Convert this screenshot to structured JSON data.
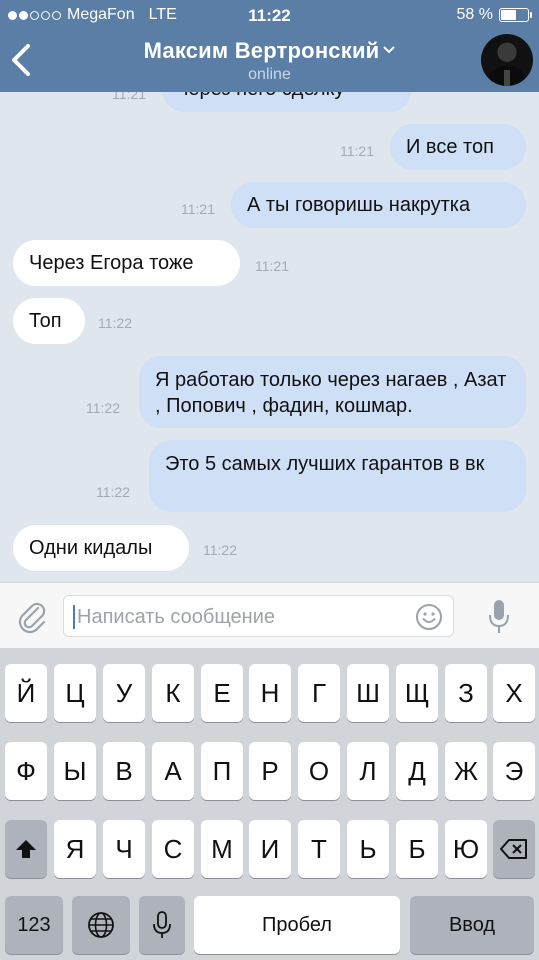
{
  "status_bar": {
    "carrier": "MegaFon",
    "network": "LTE",
    "time": "11:22",
    "battery_percent_text": "58 %",
    "battery_level": 0.58
  },
  "header": {
    "title": "Максим Вертронский",
    "subtitle": "online",
    "back_icon": "chevron-left-icon",
    "title_chevron_icon": "chevron-down-icon"
  },
  "messages": [
    {
      "text": "через него сделку",
      "time": "11:21",
      "direction": "out"
    },
    {
      "text": "И все топ",
      "time": "11:21",
      "direction": "out"
    },
    {
      "text": "А ты говоришь накрутка",
      "time": "11:21",
      "direction": "out"
    },
    {
      "text": "Через Егора тоже",
      "time": "11:21",
      "direction": "in"
    },
    {
      "text": "Топ",
      "time": "11:22",
      "direction": "in"
    },
    {
      "text": "Я работаю только через нагаев , Азат , Попович , фадин, кошмар.",
      "time": "11:22",
      "direction": "out"
    },
    {
      "text": "Это 5 самых лучших гарантов в вк",
      "time": "11:22",
      "direction": "out"
    },
    {
      "text": "Одни кидалы",
      "time": "11:22",
      "direction": "in"
    }
  ],
  "composer": {
    "placeholder": "Написать сообщение",
    "attach_icon": "paperclip-icon",
    "emoji_icon": "smiley-icon",
    "voice_icon": "microphone-icon"
  },
  "keyboard": {
    "row1": [
      "Й",
      "Ц",
      "У",
      "К",
      "Е",
      "Н",
      "Г",
      "Ш",
      "Щ",
      "З",
      "Х"
    ],
    "row2": [
      "Ф",
      "Ы",
      "В",
      "А",
      "П",
      "Р",
      "О",
      "Л",
      "Д",
      "Ж",
      "Э"
    ],
    "row3": [
      "Я",
      "Ч",
      "С",
      "М",
      "И",
      "Т",
      "Ь",
      "Б",
      "Ю"
    ],
    "numbers_label": "123",
    "space_label": "Пробел",
    "return_label": "Ввод",
    "shift_icon": "shift-icon",
    "delete_icon": "backspace-icon",
    "globe_icon": "globe-icon",
    "dictation_icon": "microphone-icon"
  },
  "colors": {
    "header": "#5a7ea6",
    "chat_background": "#dfe6ee",
    "outgoing_bubble": "#cfdff5",
    "incoming_bubble": "#ffffff"
  }
}
